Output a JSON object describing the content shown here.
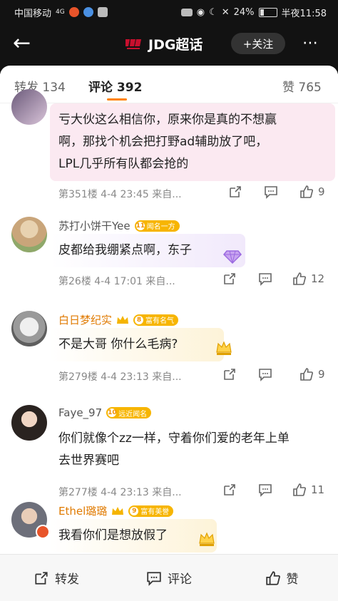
{
  "status": {
    "carrier": "中国移动",
    "network": "4G",
    "battery": "24%",
    "time": "半夜11:58"
  },
  "header": {
    "title": "JDG超话",
    "follow_label": "+关注",
    "more": "⋯",
    "back": "←"
  },
  "tabs": [
    {
      "label": "转发 134"
    },
    {
      "label": "评论 392"
    },
    {
      "label": "赞 765"
    }
  ],
  "comments": [
    {
      "author": "",
      "text_lines": [
        "亏大伙这么相信你，原来你是真的不想赢",
        "啊，那找个机会把打野ad辅助放了吧，",
        "LPL几乎所有队都会抢的"
      ],
      "meta": "第351楼 4-4 23:45 来自...",
      "likes": "9"
    },
    {
      "author": "苏打小饼干Yee",
      "badge_level": "11",
      "badge_text": "闻名一方",
      "text_lines": [
        "皮都给我绷紧点啊，东子"
      ],
      "meta": "第26楼 4-4 17:01 来自...",
      "likes": "12"
    },
    {
      "author": "白日梦纪实",
      "badge_level": "8",
      "badge_text": "富有名气",
      "text_lines": [
        "不是大哥 你什么毛病?"
      ],
      "meta": "第279楼 4-4 23:13 来自...",
      "likes": "9"
    },
    {
      "author": "Faye_97",
      "badge_level": "10",
      "badge_text": "远近闻名",
      "text_lines": [
        "你们就像个zz一样，守着你们爱的老年上单",
        "去世界赛吧"
      ],
      "meta": "第277楼 4-4 23:13 来自...",
      "likes": "11"
    },
    {
      "author": "Ethel璐璐",
      "badge_level": "9",
      "badge_text": "富有美誉",
      "text_lines": [
        "我看你们是想放假了"
      ],
      "meta": "",
      "likes": ""
    }
  ],
  "bottom_bar": {
    "repost": "转发",
    "comment": "评论",
    "like": "赞"
  },
  "colors": {
    "accent": "#ff8200",
    "badge": "#f7b500",
    "header_bg": "#121212"
  }
}
